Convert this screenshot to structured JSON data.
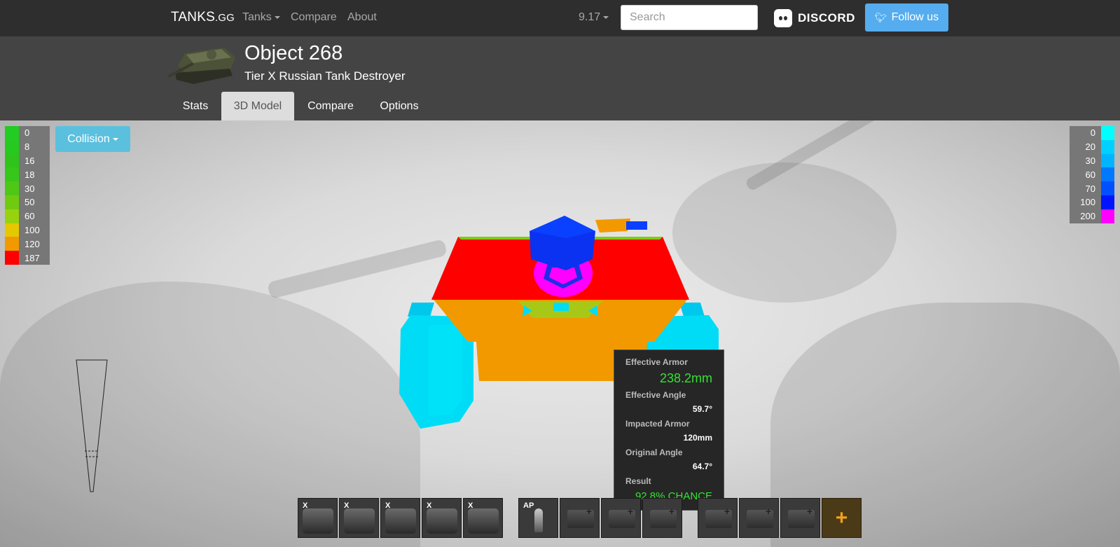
{
  "nav": {
    "brand": "TANKS",
    "brand_suffix": ".GG",
    "tanks": "Tanks",
    "compare": "Compare",
    "about": "About",
    "version": "9.17",
    "search_placeholder": "Search",
    "discord": "DISCORD",
    "follow": "Follow us"
  },
  "header": {
    "title": "Object 268",
    "subtitle": "Tier X Russian Tank Destroyer",
    "tabs": [
      "Stats",
      "3D Model",
      "Compare",
      "Options"
    ],
    "active_tab": "3D Model"
  },
  "viewer": {
    "collision_label": "Collision",
    "legend_left": [
      {
        "value": "0",
        "color": "#22cc22"
      },
      {
        "value": "8",
        "color": "#26c91f"
      },
      {
        "value": "16",
        "color": "#2ec41c"
      },
      {
        "value": "18",
        "color": "#37c61a"
      },
      {
        "value": "30",
        "color": "#4ec815"
      },
      {
        "value": "50",
        "color": "#6fcb10"
      },
      {
        "value": "60",
        "color": "#98d20c"
      },
      {
        "value": "100",
        "color": "#e5c800"
      },
      {
        "value": "120",
        "color": "#f29900"
      },
      {
        "value": "187",
        "color": "#ff0000"
      }
    ],
    "legend_right": [
      {
        "value": "0",
        "color": "#00ffff"
      },
      {
        "value": "20",
        "color": "#00d0ff"
      },
      {
        "value": "30",
        "color": "#00b4ff"
      },
      {
        "value": "60",
        "color": "#0078ff"
      },
      {
        "value": "70",
        "color": "#0050ff"
      },
      {
        "value": "100",
        "color": "#0014ff"
      },
      {
        "value": "200",
        "color": "#ff00ff"
      }
    ],
    "tooltip": {
      "effective_armor_label": "Effective Armor",
      "effective_armor": "238.2mm",
      "effective_angle_label": "Effective Angle",
      "effective_angle": "59.7°",
      "impacted_armor_label": "Impacted Armor",
      "impacted_armor": "120mm",
      "original_angle_label": "Original Angle",
      "original_angle": "64.7°",
      "result_label": "Result",
      "result": "92.8% CHANCE"
    },
    "modules": [
      {
        "badge": "X",
        "icon": "gun-icon"
      },
      {
        "badge": "X",
        "icon": "turret-icon"
      },
      {
        "badge": "X",
        "icon": "engine-icon"
      },
      {
        "badge": "X",
        "icon": "tracks-icon"
      },
      {
        "badge": "X",
        "icon": "radio-icon"
      }
    ],
    "ammo": [
      {
        "badge": "AP",
        "icon": "shell-icon"
      },
      {
        "badge": "",
        "icon": "empty-slot-icon"
      },
      {
        "badge": "",
        "icon": "empty-slot-icon"
      },
      {
        "badge": "",
        "icon": "empty-slot-icon"
      }
    ],
    "consumables": [
      {
        "icon": "empty-slot-icon"
      },
      {
        "icon": "empty-slot-icon"
      },
      {
        "icon": "empty-slot-icon"
      },
      {
        "icon": "add-icon",
        "label": "+"
      }
    ]
  },
  "colors": {
    "armor_red": "#ff0000",
    "armor_orange": "#f29900",
    "armor_cyan": "#00dcf5",
    "armor_blue": "#0040f0",
    "armor_magenta": "#ff00ff",
    "tooltip_green": "#33e233"
  }
}
